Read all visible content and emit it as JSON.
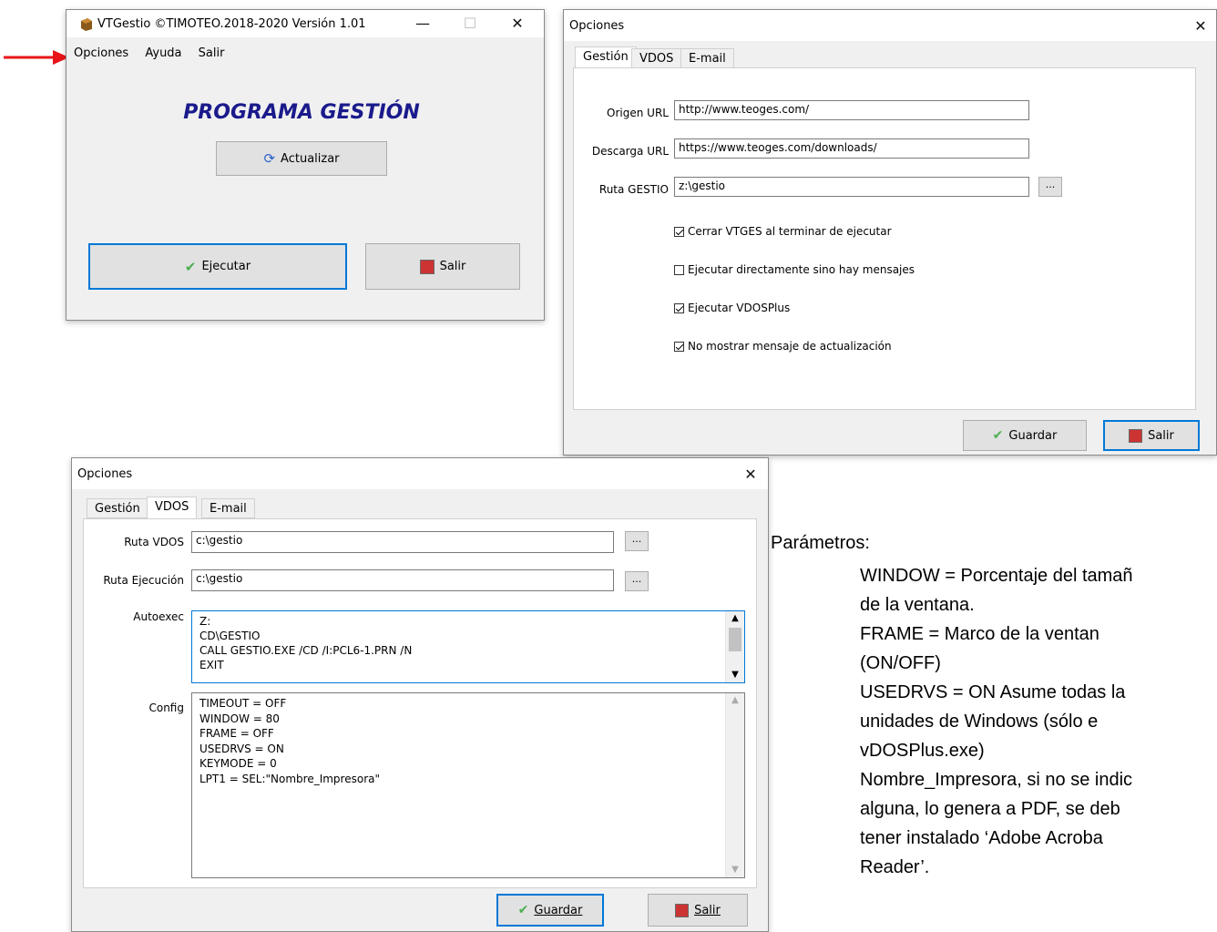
{
  "main_window": {
    "title": "VTGestio  ©TIMOTEO.2018-2020  Versión 1.01",
    "menu": [
      "Opciones",
      "Ayuda",
      "Salir"
    ],
    "heading": "PROGRAMA GESTIÓN",
    "update_button": "Actualizar",
    "run_button": "Ejecutar",
    "exit_button": "Salir"
  },
  "options_gestion": {
    "title": "Opciones",
    "tabs": [
      "Gestión",
      "VDOS",
      "E-mail"
    ],
    "active_tab": "Gestión",
    "fields": [
      {
        "label": "Origen URL",
        "value": "http://www.teoges.com/"
      },
      {
        "label": "Descarga URL",
        "value": "https://www.teoges.com/downloads/"
      },
      {
        "label": "Ruta GESTIO",
        "value": "z:\\gestio"
      }
    ],
    "browse_button": "...",
    "checkboxes": [
      {
        "label": "Cerrar VTGES al terminar de ejecutar",
        "checked": true
      },
      {
        "label": "Ejecutar directamente sino hay mensajes",
        "checked": false
      },
      {
        "label": "Ejecutar VDOSPlus",
        "checked": true
      },
      {
        "label": "No mostrar mensaje de actualización",
        "checked": true
      }
    ],
    "save_button": "Guardar",
    "exit_button": "Salir"
  },
  "options_vdos": {
    "title": "Opciones",
    "tabs": [
      "Gestión",
      "VDOS",
      "E-mail"
    ],
    "active_tab": "VDOS",
    "ruta_vdos_label": "Ruta VDOS",
    "ruta_vdos_value": "c:\\gestio",
    "ruta_ejec_label": "Ruta Ejecución",
    "ruta_ejec_value": "c:\\gestio",
    "browse_button": "...",
    "autoexec_label": "Autoexec",
    "autoexec_lines": [
      "Z:",
      "CD\\GESTIO",
      "CALL GESTIO.EXE /CD /I:PCL6-1.PRN /N",
      "EXIT"
    ],
    "config_label": "Config",
    "config_lines": [
      "TIMEOUT = OFF",
      "WINDOW = 80",
      "FRAME = OFF",
      "USEDRVS = ON",
      "KEYMODE = 0",
      "LPT1 = SEL:\"Nombre_Impresora\""
    ],
    "save_button": "Guardar",
    "exit_button": "Salir"
  },
  "doc_text": {
    "heading": "Parámetros:",
    "lines": [
      "WINDOW = Porcentaje del tamañ",
      "de la ventana.",
      "FRAME = Marco de la ventan",
      "(ON/OFF)",
      "USEDRVS = ON  Asume todas la",
      "unidades de Windows (sólo e",
      "vDOSPlus.exe)",
      "Nombre_Impresora, si no se indic",
      "alguna, lo genera a PDF, se deb",
      "tener instalado ‘Adobe Acroba",
      "Reader’."
    ]
  },
  "colors": {
    "accent": "#0078d7",
    "heading": "#1a1a8c",
    "arrow": "#e8141a",
    "check_icon": "#4caf50"
  }
}
